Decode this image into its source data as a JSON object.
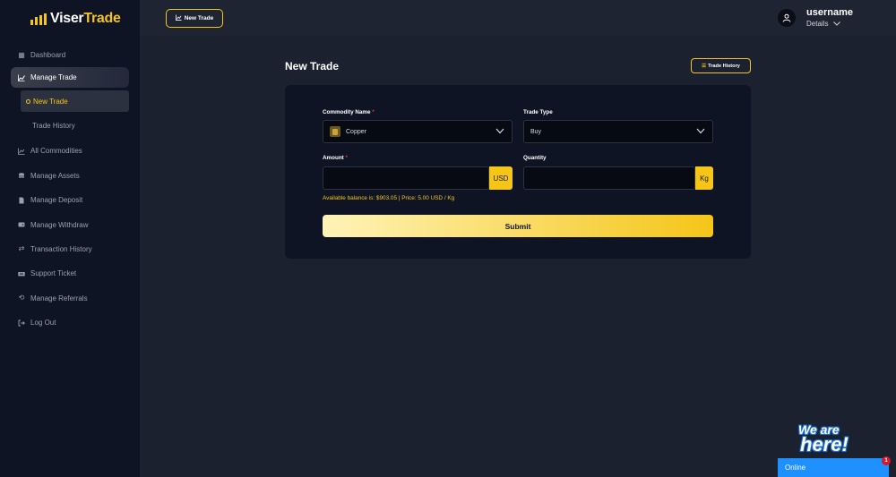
{
  "brand": {
    "name_part1": "Viser",
    "name_part2": "Trade"
  },
  "sidebar": {
    "items": [
      {
        "label": "Dashboard",
        "icon": "grid-icon"
      },
      {
        "label": "Manage Trade",
        "icon": "chart-line-icon"
      },
      {
        "label": "All Commodities",
        "icon": "chart-icon"
      },
      {
        "label": "Manage Assets",
        "icon": "coins-icon"
      },
      {
        "label": "Manage Deposit",
        "icon": "file-icon"
      },
      {
        "label": "Manage Withdraw",
        "icon": "wallet-icon"
      },
      {
        "label": "Transaction History",
        "icon": "exchange-icon"
      },
      {
        "label": "Support Ticket",
        "icon": "ticket-icon"
      },
      {
        "label": "Manage Referrals",
        "icon": "repeat-icon"
      },
      {
        "label": "Log Out",
        "icon": "logout-icon"
      }
    ],
    "sub_items": [
      {
        "label": "New Trade"
      },
      {
        "label": "Trade History"
      }
    ]
  },
  "header": {
    "new_trade_label": "New Trade",
    "username": "username",
    "details_label": "Details"
  },
  "main": {
    "title": "New Trade",
    "trade_history_label": "Trade History",
    "form": {
      "commodity_label": "Commodity Name",
      "commodity_value": "Copper",
      "trade_type_label": "Trade Type",
      "trade_type_value": "Buy",
      "amount_label": "Amount",
      "amount_unit": "USD",
      "quantity_label": "Quantity",
      "quantity_unit": "Kg",
      "required_mark": "*",
      "balance_text": "Available balance is: $903.05 | Price: 5.00 USD / Kg",
      "submit_label": "Submit"
    }
  },
  "chat": {
    "badge_line1": "We are",
    "badge_line2": "here!",
    "status": "Online",
    "count": "1"
  },
  "colors": {
    "accent": "#f5c518",
    "sidebar_bg": "#0f1424",
    "page_bg": "#1c2130",
    "chat_blue": "#1e90ff"
  }
}
